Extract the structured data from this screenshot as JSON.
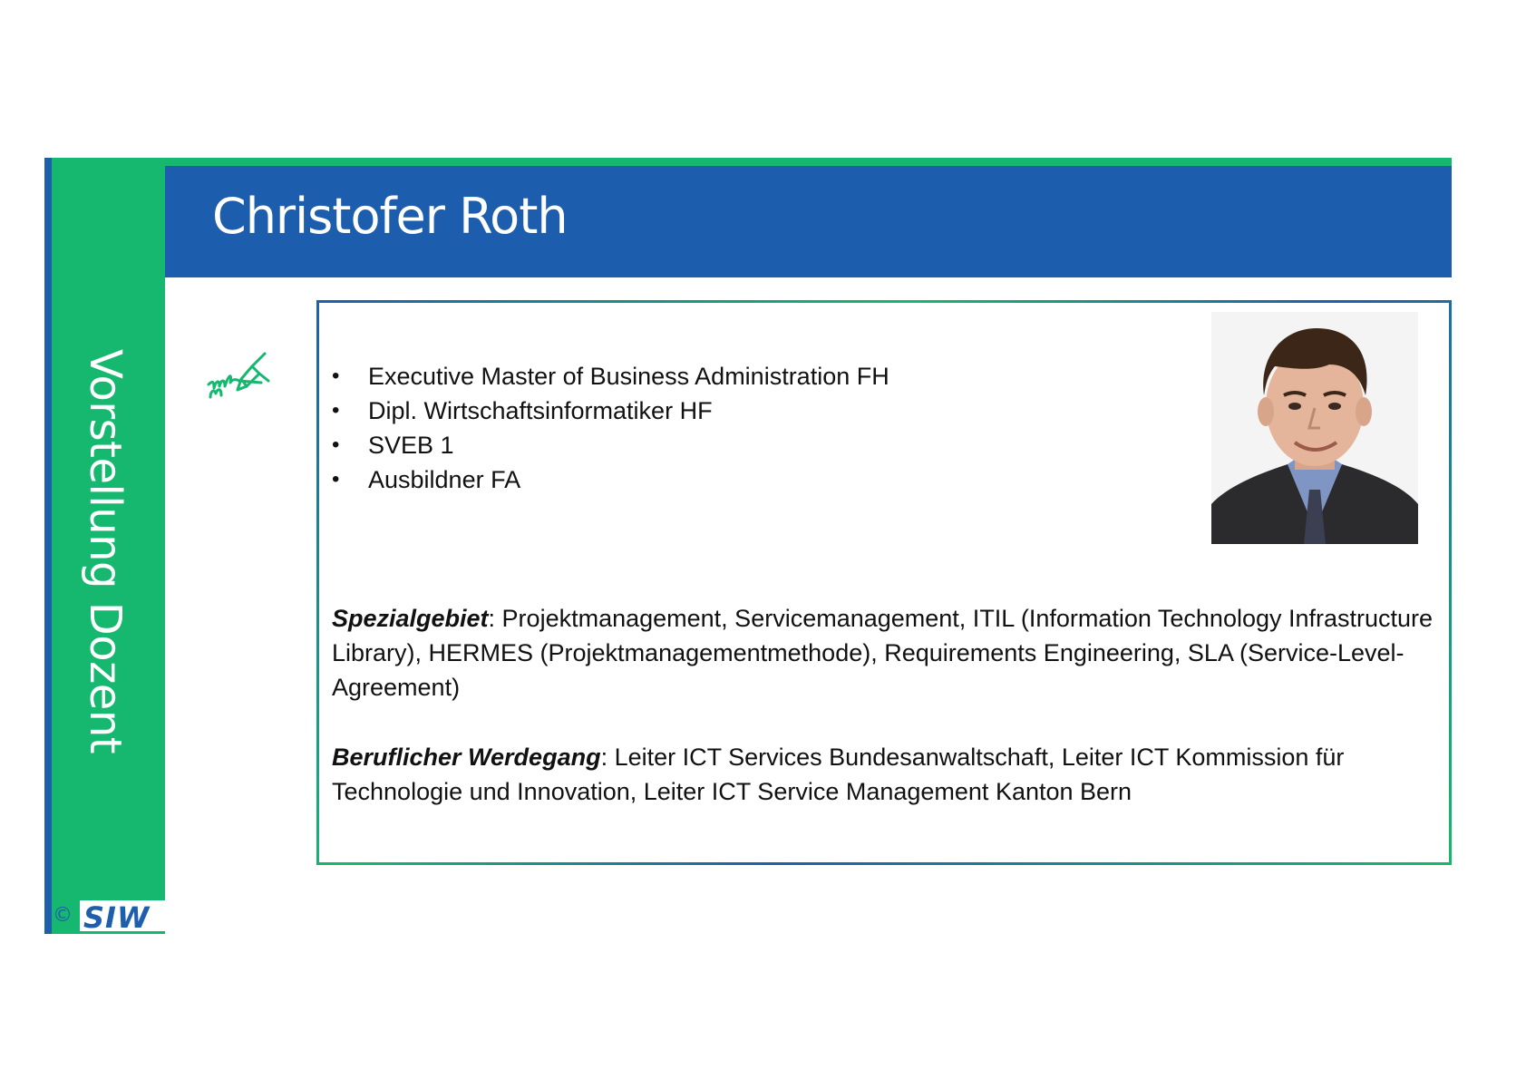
{
  "sidebar": {
    "title": "Vorstellung Dozent"
  },
  "header": {
    "name": "Christofer Roth"
  },
  "qualifications": [
    "Executive Master of Business Administration FH",
    "Dipl. Wirtschaftsinformatiker HF",
    "SVEB 1",
    "Ausbildner FA"
  ],
  "specialty": {
    "label": "Spezialgebiet",
    "text": ": Projektmanagement, Servicemanagement, ITIL (Information Technology Infrastructure Library), HERMES (Projektmanagementmethode), Requirements Engineering, SLA (Service-Level-Agreement)"
  },
  "career": {
    "label": "Beruflicher Werdegang",
    "text": ": Leiter ICT Services Bundesanwaltschaft, Leiter ICT Kommission für Technologie und Innovation, Leiter ICT Service Management Kanton Bern"
  },
  "logo": {
    "copyright": "©",
    "text": "SIW"
  },
  "colors": {
    "green": "#15b86e",
    "blue": "#1c5dad"
  },
  "icons": {
    "signature": "signature-pen-icon"
  }
}
